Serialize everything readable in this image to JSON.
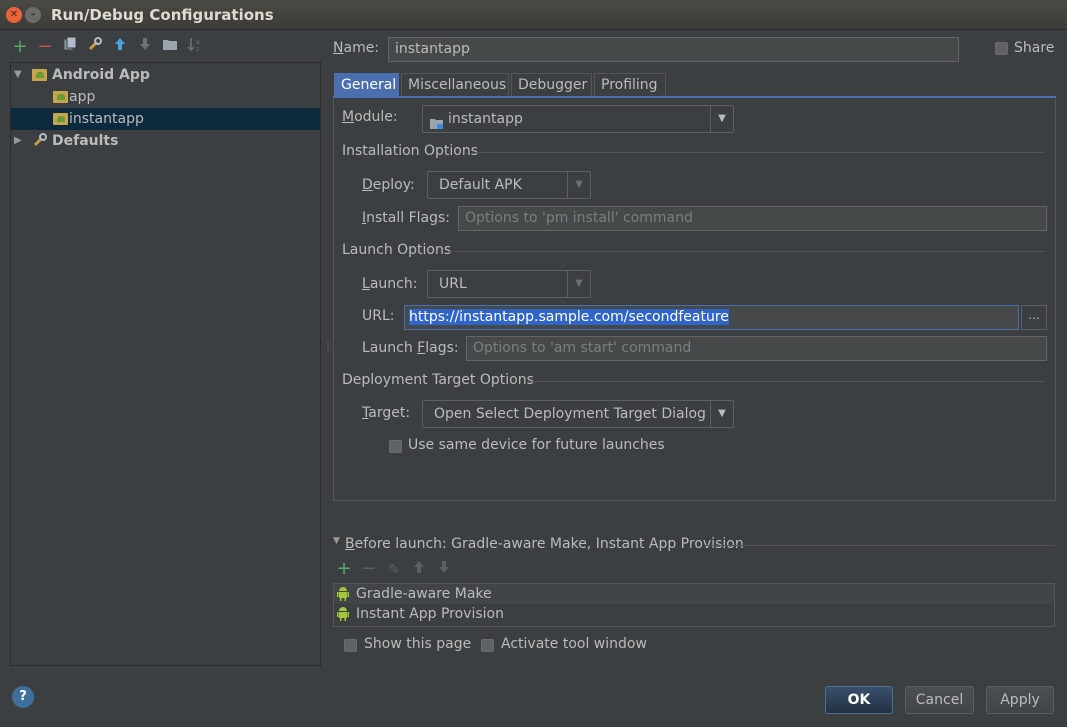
{
  "window": {
    "title": "Run/Debug Configurations"
  },
  "left_toolbar": {
    "icons": [
      "add-icon",
      "remove-icon",
      "copy-icon",
      "edit-defaults-icon",
      "move-up-icon",
      "move-down-icon",
      "folder-icon",
      "sort-icon"
    ]
  },
  "tree": {
    "items": [
      {
        "label": "Android App",
        "expanded": true,
        "bold": true
      },
      {
        "label": "app"
      },
      {
        "label": "instantapp",
        "selected": true
      },
      {
        "label": "Defaults",
        "bold": true
      }
    ]
  },
  "name_row": {
    "label": "Name:",
    "value": "instantapp",
    "share_label": "Share",
    "share_checked": false
  },
  "tabs": [
    {
      "label": "General",
      "active": true
    },
    {
      "label": "Miscellaneous"
    },
    {
      "label": "Debugger"
    },
    {
      "label": "Profiling"
    }
  ],
  "general": {
    "module_label": "Module:",
    "module_value": "instantapp",
    "installation_title": "Installation Options",
    "deploy_label": "Deploy:",
    "deploy_value": "Default APK",
    "install_flags_label": "Install Flags:",
    "install_flags_placeholder": "Options to 'pm install' command",
    "launch_title": "Launch Options",
    "launch_label": "Launch:",
    "launch_value": "URL",
    "url_label": "URL:",
    "url_value": "https://instantapp.sample.com/secondfeature",
    "url_browse": "...",
    "launch_flags_label": "Launch Flags:",
    "launch_flags_placeholder": "Options to 'am start' command",
    "deployment_title": "Deployment Target Options",
    "target_label": "Target:",
    "target_value": "Open Select Deployment Target Dialog",
    "same_device_label": "Use same device for future launches",
    "same_device_checked": false
  },
  "before_launch": {
    "title": "Before launch: Gradle-aware Make, Instant App Provision",
    "toolbar_icons": [
      "add-icon",
      "remove-icon",
      "edit-icon",
      "move-up-icon",
      "move-down-icon"
    ],
    "items": [
      "Gradle-aware Make",
      "Instant App Provision"
    ],
    "show_page_label": "Show this page",
    "activate_tool_window_label": "Activate tool window"
  },
  "buttons": {
    "help": "?",
    "ok": "OK",
    "cancel": "Cancel",
    "apply": "Apply"
  },
  "colors": {
    "accent": "#4b6eaf",
    "selection": "#2f65ca",
    "tree_selection": "#0d293e",
    "add": "#59a869",
    "android": "#a4c639"
  }
}
